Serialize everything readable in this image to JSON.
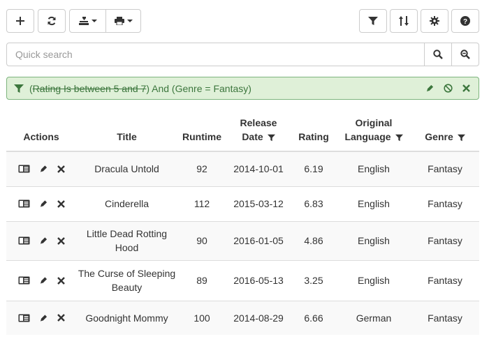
{
  "toolbar": {
    "add_icon": "plus-icon",
    "refresh_icon": "refresh-icon",
    "export_icon": "export-icon",
    "print_icon": "print-icon",
    "filter_icon": "filter-icon",
    "sort_icon": "sort-icon",
    "settings_icon": "gear-icon",
    "help_icon": "help-icon"
  },
  "search": {
    "placeholder": "Quick search",
    "value": ""
  },
  "filter": {
    "open_paren": "(",
    "struck_condition": "Rating Is between 5 and 7",
    "rest": ") And (Genre = Fantasy)"
  },
  "table": {
    "headers": {
      "actions": "Actions",
      "title": "Title",
      "runtime": "Runtime",
      "release_date_line1": "Release",
      "release_date_line2": "Date",
      "rating": "Rating",
      "language_line1": "Original",
      "language_line2": "Language",
      "genre": "Genre"
    },
    "rows": [
      {
        "title": "Dracula Untold",
        "runtime": "92",
        "release_date": "2014-10-01",
        "rating": "6.19",
        "language": "English",
        "genre": "Fantasy"
      },
      {
        "title": "Cinderella",
        "runtime": "112",
        "release_date": "2015-03-12",
        "rating": "6.83",
        "language": "English",
        "genre": "Fantasy"
      },
      {
        "title": "Little Dead Rotting Hood",
        "runtime": "90",
        "release_date": "2016-01-05",
        "rating": "4.86",
        "language": "English",
        "genre": "Fantasy"
      },
      {
        "title": "The Curse of Sleeping Beauty",
        "runtime": "89",
        "release_date": "2016-05-13",
        "rating": "3.25",
        "language": "English",
        "genre": "Fantasy"
      },
      {
        "title": "Goodnight Mommy",
        "runtime": "100",
        "release_date": "2014-08-29",
        "rating": "6.66",
        "language": "German",
        "genre": "Fantasy"
      }
    ]
  },
  "colors": {
    "filter_bg": "#dff0d8",
    "filter_text": "#3c763d",
    "border": "#cccccc"
  }
}
